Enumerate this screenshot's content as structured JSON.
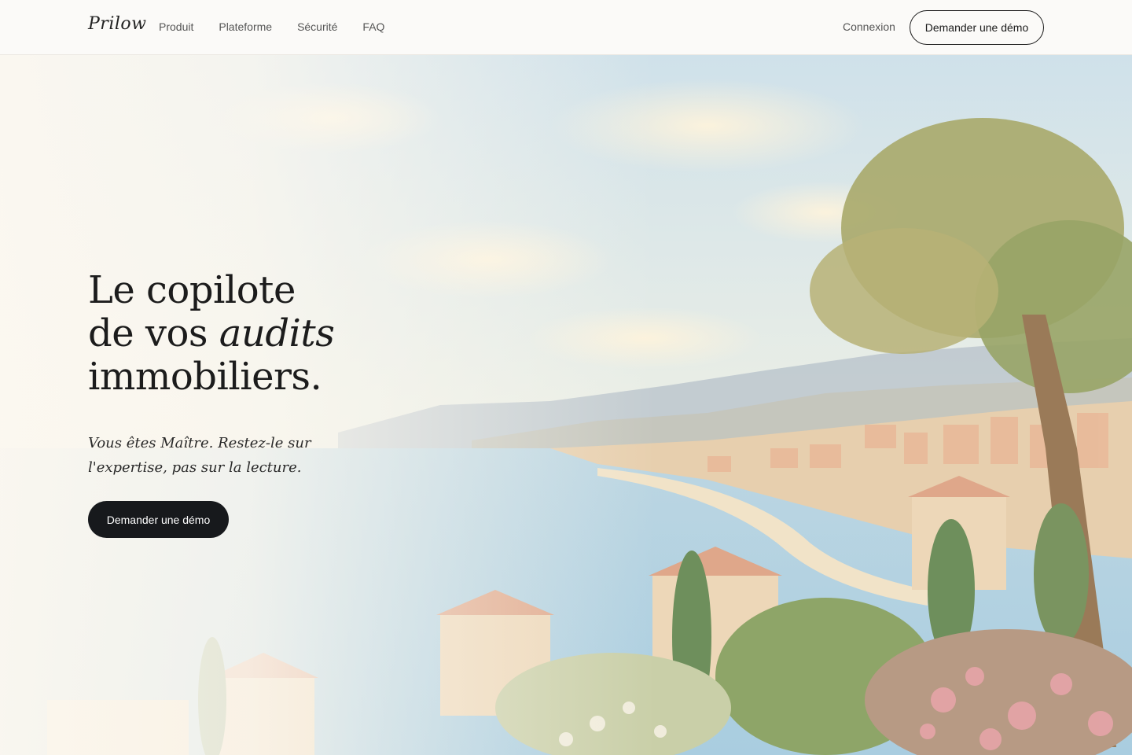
{
  "brand": {
    "logo": "Prilow"
  },
  "nav": {
    "items": [
      {
        "label": "Produit"
      },
      {
        "label": "Plateforme"
      },
      {
        "label": "Sécurité"
      },
      {
        "label": "FAQ"
      }
    ],
    "login_label": "Connexion",
    "demo_label": "Demander une démo"
  },
  "hero": {
    "headline_line1": "Le copilote",
    "headline_line2_prefix": "de vos ",
    "headline_line2_italic": "audits",
    "headline_line3": "immobiliers.",
    "subtitle": "Vous êtes Maître. Restez-le sur l'expertise, pas sur la lecture.",
    "cta_label": "Demander une démo",
    "background_image": "painted-riviera-coastline"
  },
  "colors": {
    "cta_dark": "#17191c",
    "text": "#1c1c1c",
    "nav_text": "#555555",
    "background": "#fbfaf8"
  }
}
